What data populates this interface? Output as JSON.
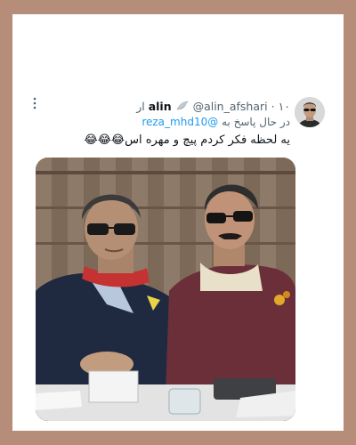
{
  "tweet": {
    "display_name": "alin",
    "handle": "@alin_afshari",
    "separator": "·",
    "time": "۱۰ ار",
    "reply_prefix": "در حال پاسخ به",
    "reply_to": "@reza_mhd10",
    "text": "یه لحظه فکر کردم پیچ و مهره اس😂😂😂",
    "verified_emoji": "white-wing-emoji"
  },
  "icons": {
    "more": "more-vertical-icon",
    "avatar": "profile-avatar"
  },
  "colors": {
    "background_frame": "#b58d78",
    "link_blue": "#1d9bf0",
    "text_primary": "#0f1419",
    "text_secondary": "#536471"
  }
}
